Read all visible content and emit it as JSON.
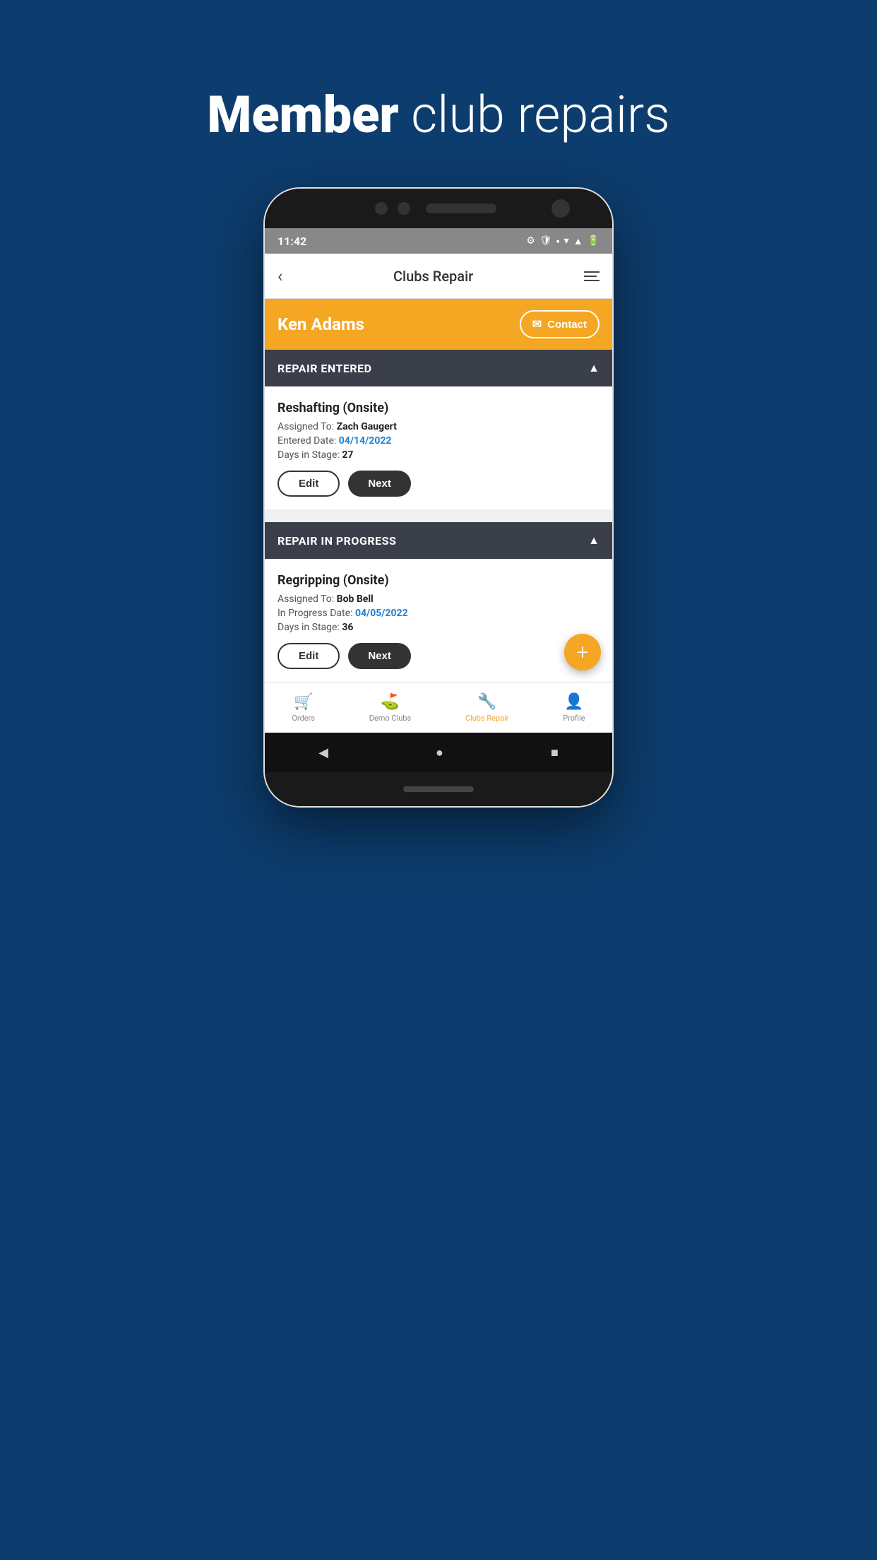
{
  "page": {
    "background_title_bold": "Member",
    "background_title_light": " club repairs"
  },
  "status_bar": {
    "time": "11:42",
    "icons": [
      "⚙",
      "🛡",
      "▪",
      "▾",
      "▲",
      "🔋"
    ]
  },
  "app_header": {
    "title": "Clubs Repair",
    "back_label": "‹",
    "menu_label": "menu"
  },
  "customer": {
    "name": "Ken Adams",
    "contact_label": "Contact"
  },
  "sections": [
    {
      "id": "repair-entered",
      "title": "REPAIR ENTERED",
      "repairs": [
        {
          "type": "Reshafting (Onsite)",
          "assigned_to_label": "Assigned To:",
          "assigned_to": "Zach Gaugert",
          "entered_date_label": "Entered Date:",
          "entered_date": "04/14/2022",
          "days_label": "Days in Stage:",
          "days": "27",
          "edit_label": "Edit",
          "next_label": "Next"
        }
      ]
    },
    {
      "id": "repair-in-progress",
      "title": "REPAIR IN PROGRESS",
      "repairs": [
        {
          "type": "Regripping (Onsite)",
          "assigned_to_label": "Assigned To:",
          "assigned_to": "Bob Bell",
          "entered_date_label": "In Progress Date:",
          "entered_date": "04/05/2022",
          "days_label": "Days in Stage:",
          "days": "36",
          "edit_label": "Edit",
          "next_label": "Next"
        }
      ]
    }
  ],
  "bottom_nav": {
    "items": [
      {
        "label": "Orders",
        "icon": "🛒",
        "active": false
      },
      {
        "label": "Demo Clubs",
        "icon": "⛳",
        "active": false
      },
      {
        "label": "Clubs Repair",
        "icon": "🔧",
        "active": true
      },
      {
        "label": "Profile",
        "icon": "👤",
        "active": false
      }
    ]
  },
  "fab_label": "+",
  "android_nav": {
    "back": "◀",
    "home": "●",
    "recent": "■"
  }
}
